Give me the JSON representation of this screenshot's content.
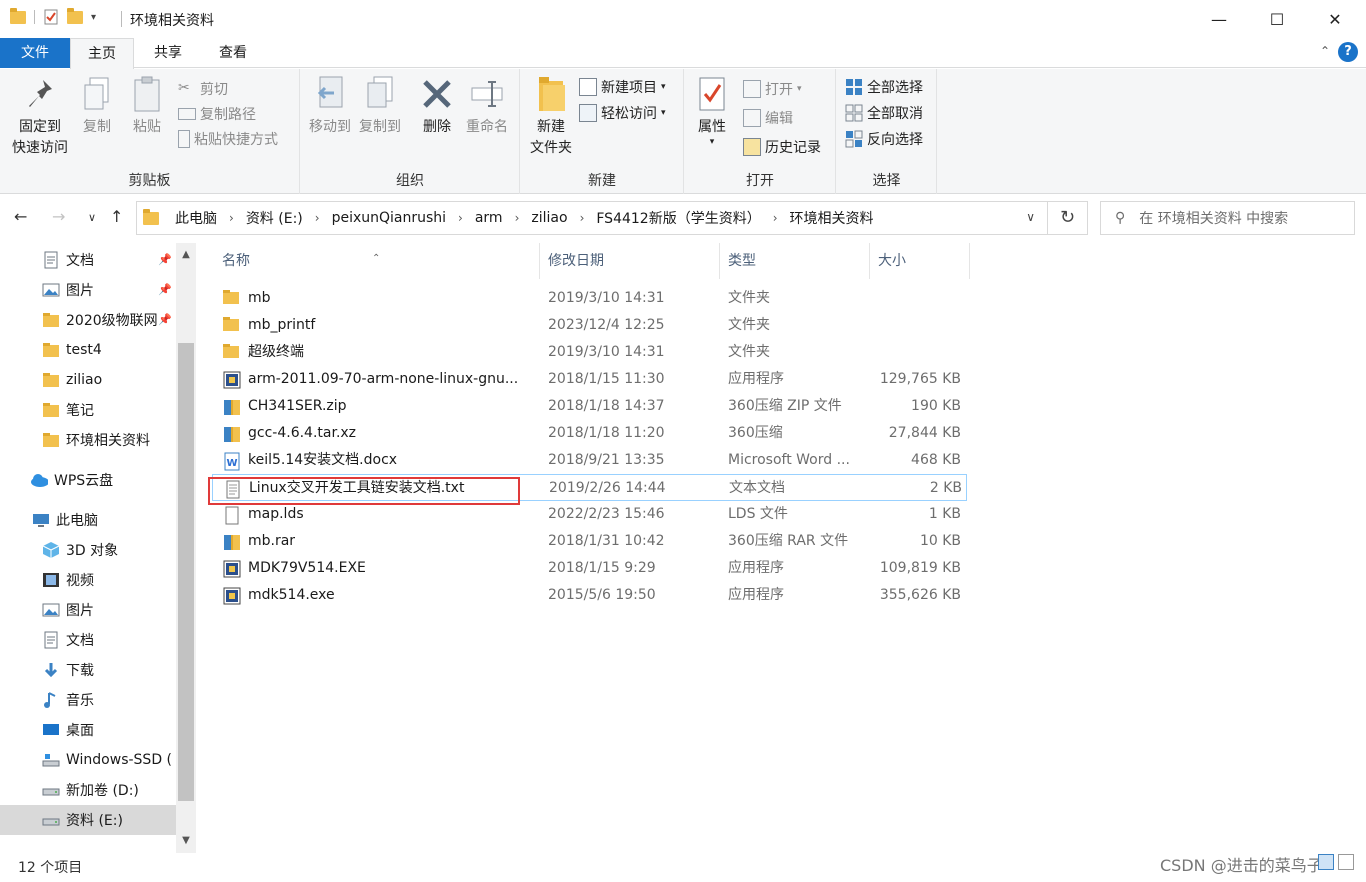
{
  "window": {
    "title": "环境相关资料",
    "minimize_glyph": "—",
    "maximize_glyph": "☐",
    "close_glyph": "✕"
  },
  "ribbon_tabs": [
    "文件",
    "主页",
    "共享",
    "查看"
  ],
  "ribbon": {
    "clipboard": {
      "group": "剪贴板",
      "pin_line1": "固定到",
      "pin_line2": "快速访问",
      "copy": "复制",
      "paste": "粘贴",
      "cut": "剪切",
      "copy_path": "复制路径",
      "paste_shortcut": "粘贴快捷方式"
    },
    "organize": {
      "group": "组织",
      "move_to": "移动到",
      "copy_to": "复制到",
      "delete": "删除",
      "rename": "重命名"
    },
    "new": {
      "group": "新建",
      "new_folder_line1": "新建",
      "new_folder_line2": "文件夹",
      "new_item": "新建项目",
      "easy_access": "轻松访问"
    },
    "open": {
      "group": "打开",
      "properties": "属性",
      "open": "打开",
      "edit": "编辑",
      "history": "历史记录"
    },
    "select": {
      "group": "选择",
      "select_all": "全部选择",
      "select_none": "全部取消",
      "invert": "反向选择"
    }
  },
  "breadcrumb": [
    "此电脑",
    "资料 (E:)",
    "peixunQianrushi",
    "arm",
    "ziliao",
    "FS4412新版（学生资料）",
    "环境相关资料"
  ],
  "search": {
    "placeholder": "在 环境相关资料 中搜索"
  },
  "nav_pane": [
    {
      "label": "文档",
      "icon": "documents-icon",
      "pinned": true
    },
    {
      "label": "图片",
      "icon": "pictures-icon",
      "pinned": true
    },
    {
      "label": "2020级物联网",
      "icon": "folder-icon",
      "pinned": true
    },
    {
      "label": "test4",
      "icon": "folder-icon",
      "pinned": false
    },
    {
      "label": "ziliao",
      "icon": "folder-icon",
      "pinned": false
    },
    {
      "label": "笔记",
      "icon": "folder-icon",
      "pinned": false
    },
    {
      "label": "环境相关资料",
      "icon": "folder-icon",
      "pinned": false
    },
    {
      "label": "WPS云盘",
      "icon": "cloud-icon",
      "pinned": false
    },
    {
      "label": "此电脑",
      "icon": "computer-icon",
      "pinned": false
    },
    {
      "label": "3D 对象",
      "icon": "3d-objects-icon",
      "pinned": false
    },
    {
      "label": "视频",
      "icon": "videos-icon",
      "pinned": false
    },
    {
      "label": "图片",
      "icon": "pictures-icon",
      "pinned": false
    },
    {
      "label": "文档",
      "icon": "documents-icon",
      "pinned": false
    },
    {
      "label": "下载",
      "icon": "downloads-icon",
      "pinned": false
    },
    {
      "label": "音乐",
      "icon": "music-icon",
      "pinned": false
    },
    {
      "label": "桌面",
      "icon": "desktop-icon",
      "pinned": false
    },
    {
      "label": "Windows-SSD (",
      "icon": "windows-drive-icon",
      "pinned": false
    },
    {
      "label": "新加卷 (D:)",
      "icon": "drive-icon",
      "pinned": false
    },
    {
      "label": "资料 (E:)",
      "icon": "drive-icon",
      "pinned": false
    }
  ],
  "columns": {
    "name": "名称",
    "date": "修改日期",
    "type": "类型",
    "size": "大小"
  },
  "files": [
    {
      "name": "mb",
      "date": "2019/3/10 14:31",
      "type": "文件夹",
      "size": "",
      "icon": "folder-icon"
    },
    {
      "name": "mb_printf",
      "date": "2023/12/4 12:25",
      "type": "文件夹",
      "size": "",
      "icon": "folder-icon"
    },
    {
      "name": "超级终端",
      "date": "2019/3/10 14:31",
      "type": "文件夹",
      "size": "",
      "icon": "folder-icon"
    },
    {
      "name": "arm-2011.09-70-arm-none-linux-gnu...",
      "date": "2018/1/15 11:30",
      "type": "应用程序",
      "size": "129,765 KB",
      "icon": "installer-icon"
    },
    {
      "name": "CH341SER.zip",
      "date": "2018/1/18 14:37",
      "type": "360压缩 ZIP 文件",
      "size": "190 KB",
      "icon": "archive-icon"
    },
    {
      "name": "gcc-4.6.4.tar.xz",
      "date": "2018/1/18 11:20",
      "type": "360压缩",
      "size": "27,844 KB",
      "icon": "archive-icon"
    },
    {
      "name": "keil5.14安装文档.docx",
      "date": "2018/9/21 13:35",
      "type": "Microsoft Word ...",
      "size": "468 KB",
      "icon": "word-doc-icon"
    },
    {
      "name": "Linux交叉开发工具链安装文档.txt",
      "date": "2019/2/26 14:44",
      "type": "文本文档",
      "size": "2 KB",
      "icon": "text-file-icon"
    },
    {
      "name": "map.lds",
      "date": "2022/2/23 15:46",
      "type": "LDS 文件",
      "size": "1 KB",
      "icon": "blank-file-icon"
    },
    {
      "name": "mb.rar",
      "date": "2018/1/31 10:42",
      "type": "360压缩 RAR 文件",
      "size": "10 KB",
      "icon": "archive-icon"
    },
    {
      "name": "MDK79V514.EXE",
      "date": "2018/1/15 9:29",
      "type": "应用程序",
      "size": "109,819 KB",
      "icon": "installer-icon"
    },
    {
      "name": "mdk514.exe",
      "date": "2015/5/6 19:50",
      "type": "应用程序",
      "size": "355,626 KB",
      "icon": "installer-icon"
    }
  ],
  "status": {
    "item_count": "12 个项目"
  },
  "watermark": "CSDN @进击的菜鸟子",
  "colors": {
    "accent": "#1a73c9",
    "highlight_box": "#e03a3a",
    "hover_row_border": "#99d1ff"
  }
}
